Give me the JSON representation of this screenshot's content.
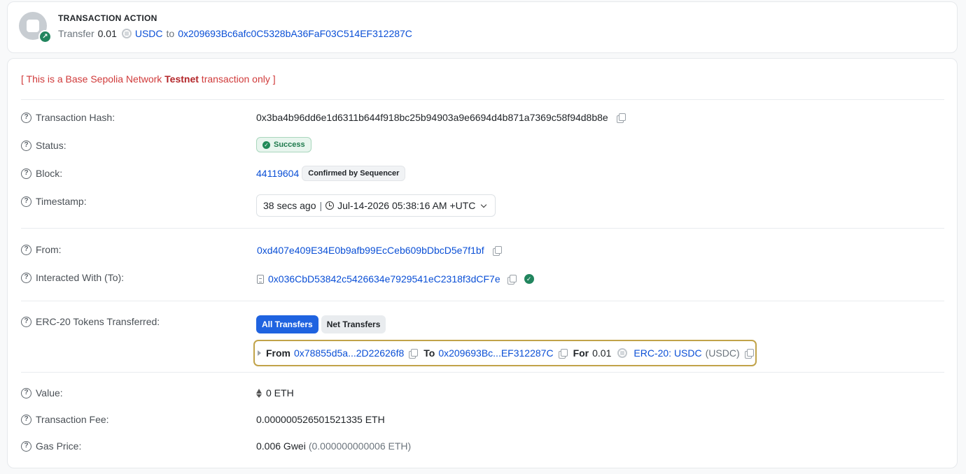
{
  "action": {
    "title": "TRANSACTION ACTION",
    "verb": "Transfer",
    "amount": "0.01",
    "token": "USDC",
    "to_word": "to",
    "to_address": "0x209693Bc6afc0C5328bA36FaF03C514EF312287C"
  },
  "notice": {
    "prefix": "[ This is a Base Sepolia Network ",
    "bold": "Testnet",
    "suffix": " transaction only ]"
  },
  "rows": {
    "hash": {
      "label": "Transaction Hash:",
      "value": "0x3ba4b96dd6e1d6311b644f918bc25b94903a9e6694d4b871a7369c58f94d8b8e"
    },
    "status": {
      "label": "Status:",
      "value": "Success"
    },
    "block": {
      "label": "Block:",
      "value": "44119604",
      "badge": "Confirmed by Sequencer"
    },
    "timestamp": {
      "label": "Timestamp:",
      "ago": "38 secs ago",
      "sep": "|",
      "date": "Jul-14-2026 05:38:16 AM +UTC"
    },
    "from": {
      "label": "From:",
      "value": "0xd407e409E34E0b9afb99EcCeb609bDbcD5e7f1bf"
    },
    "to": {
      "label": "Interacted With (To):",
      "value": "0x036CbD53842c5426634e7929541eC2318f3dCF7e"
    },
    "erc20": {
      "label": "ERC-20 Tokens Transferred:",
      "tab_all": "All Transfers",
      "tab_net": "Net Transfers",
      "transfer": {
        "from_label": "From",
        "from_addr": "0x78855d5a...2D22626f8",
        "to_label": "To",
        "to_addr": "0x209693Bc...EF312287C",
        "for_label": "For",
        "amount": "0.01",
        "token_link": "ERC-20: USDC",
        "token_symbol": "(USDC)"
      }
    },
    "value": {
      "label": "Value:",
      "value": "0 ETH"
    },
    "fee": {
      "label": "Transaction Fee:",
      "value": "0.000000526501521335 ETH"
    },
    "gas": {
      "label": "Gas Price:",
      "gwei": "0.006 Gwei",
      "eth": "(0.000000000006 ETH)"
    }
  },
  "colors": {
    "link": "#0a4fd6",
    "success": "#1f8a57",
    "notice": "#d03a3a",
    "highlight": "#c1a349"
  }
}
